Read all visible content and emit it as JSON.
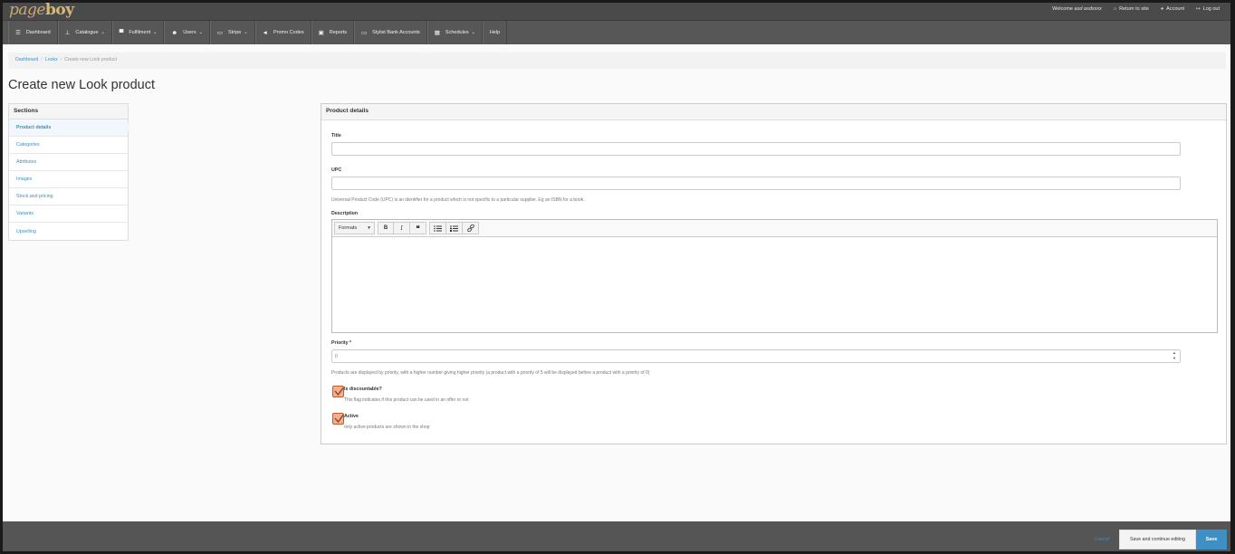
{
  "header": {
    "logo_left": "page",
    "logo_right": "boy",
    "welcome_prefix": "Welcome",
    "welcome_user": "asd asdxxxx",
    "return_to_site": "Return to site",
    "account": "Account",
    "log_out": "Log out"
  },
  "nav": {
    "items": [
      {
        "label": "Dashboard",
        "icon": "list-icon",
        "glyph": "☰",
        "caret": false
      },
      {
        "label": "Catalogue",
        "icon": "sitemap-icon",
        "glyph": "⊥",
        "caret": true
      },
      {
        "label": "Fulfilment",
        "icon": "cart-icon",
        "glyph": "▀",
        "caret": true
      },
      {
        "label": "Users",
        "icon": "users-icon",
        "glyph": "☻",
        "caret": true
      },
      {
        "label": "Stripe",
        "icon": "credit-card-icon",
        "glyph": "▭",
        "caret": true
      },
      {
        "label": "Promo Codes",
        "icon": "bullhorn-icon",
        "glyph": "◄",
        "caret": false
      },
      {
        "label": "Reports",
        "icon": "chart-icon",
        "glyph": "▣",
        "caret": false
      },
      {
        "label": "Stylist Bank Accounts",
        "icon": "credit-card-icon",
        "glyph": "▭",
        "caret": false
      },
      {
        "label": "Schedules",
        "icon": "calendar-icon",
        "glyph": "▦",
        "caret": true
      },
      {
        "label": "Help",
        "icon": "",
        "glyph": "",
        "caret": false
      }
    ]
  },
  "breadcrumb": {
    "dashboard": "Dashboard",
    "looks": "Looks",
    "current": "Create new Look product"
  },
  "page_title": "Create new Look product",
  "sections": {
    "heading": "Sections",
    "items": [
      "Product details",
      "Categories",
      "Attributes",
      "Images",
      "Stock and pricing",
      "Variants",
      "Upselling"
    ]
  },
  "panel": {
    "heading": "Product details",
    "title_label": "Title",
    "title_value": "",
    "upc_label": "UPC",
    "upc_value": "",
    "upc_help": "Universal Product Code (UPC) is an identifier for a product which is not specific to a particular supplier. Eg an ISBN for a book.",
    "description_label": "Description",
    "formats_label": "Formats",
    "priority_label": "Priority *",
    "priority_value": "0",
    "priority_help": "Products are displayed by priority, with a higher number giving higher priority (a product with a priority of 5 will be displayed before a product with a priority of 0)",
    "discountable_label": "Is discountable?",
    "discountable_help": "This flag indicates if this product can be used in an offer or not",
    "active_label": "Active",
    "active_help": "only active products are shown in the shop"
  },
  "footer": {
    "cancel": "Cancel",
    "save_continue": "Save and continue editing",
    "save": "Save"
  },
  "colors": {
    "link": "#3d8fc5",
    "primary_button": "#3d8fc5",
    "nav_bg": "#575757",
    "checkbox_accent": "#f0b08f"
  }
}
